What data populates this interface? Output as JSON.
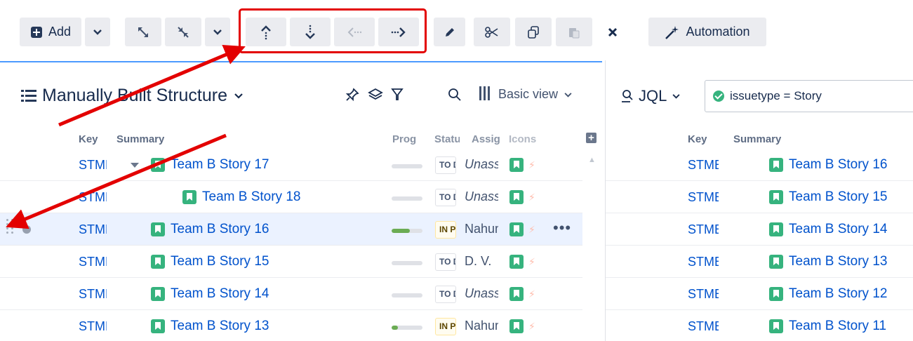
{
  "toolbar": {
    "add_label": "Add",
    "automation_label": "Automation"
  },
  "structure": {
    "title": "Manually Built Structure",
    "view_label": "Basic view"
  },
  "columns": {
    "key": "Key",
    "summary": "Summary",
    "progress": "Prog",
    "status": "Statu",
    "assignee": "Assig",
    "icons": "Icons"
  },
  "rows": [
    {
      "key": "STMB",
      "summary": "Team B Story 17",
      "progress": 0,
      "status": "TO DO",
      "assignee": "Unassigned"
    },
    {
      "key": "STMB",
      "summary": "Team B Story 18",
      "progress": 0,
      "status": "TO DO",
      "assignee": "Unassigned"
    },
    {
      "key": "STMB",
      "summary": "Team B Story 16",
      "progress": 0.6,
      "status": "IN PROGRESS",
      "assignee": "Nahum"
    },
    {
      "key": "STMB",
      "summary": "Team B Story 15",
      "progress": 0,
      "status": "TO DO",
      "assignee": "D. V."
    },
    {
      "key": "STMB",
      "summary": "Team B Story 14",
      "progress": 0,
      "status": "TO DO",
      "assignee": "Unassigned"
    },
    {
      "key": "STMB",
      "summary": "Team B Story 13",
      "progress": 0.2,
      "status": "IN PROGRESS",
      "assignee": "Nahum"
    }
  ],
  "row_more_label": "•••",
  "jql": {
    "label": "JQL",
    "query": "issuetype = Story"
  },
  "right_columns": {
    "key": "Key",
    "summary": "Summary"
  },
  "right_rows": [
    {
      "key": "STMB",
      "summary": "Team B Story 16"
    },
    {
      "key": "STMB",
      "summary": "Team B Story 15"
    },
    {
      "key": "STMB",
      "summary": "Team B Story 14"
    },
    {
      "key": "STMB",
      "summary": "Team B Story 13"
    },
    {
      "key": "STMB",
      "summary": "Team B Story 12"
    },
    {
      "key": "STMB",
      "summary": "Team B Story 11"
    }
  ],
  "colors": {
    "accent": "#0052cc",
    "story": "#36b37e",
    "annotation": "#e30000"
  }
}
